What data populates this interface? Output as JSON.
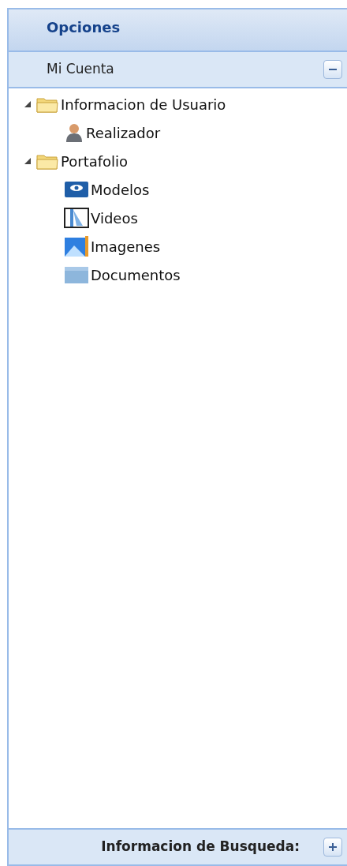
{
  "panel": {
    "title": "Opciones"
  },
  "sections": [
    {
      "title": "Mi Cuenta",
      "expanded": true,
      "tree": [
        {
          "label": "Informacion de Usuario",
          "kind": "folder",
          "expanded": true,
          "children": [
            {
              "label": "Realizador",
              "kind": "person"
            }
          ]
        },
        {
          "label": "Portafolio",
          "kind": "folder",
          "expanded": true,
          "children": [
            {
              "label": "Modelos",
              "kind": "models"
            },
            {
              "label": "Videos",
              "kind": "video"
            },
            {
              "label": "Imagenes",
              "kind": "image"
            },
            {
              "label": "Documentos",
              "kind": "document"
            }
          ]
        }
      ]
    },
    {
      "title": "Informacion de Busqueda:",
      "expanded": false
    }
  ]
}
